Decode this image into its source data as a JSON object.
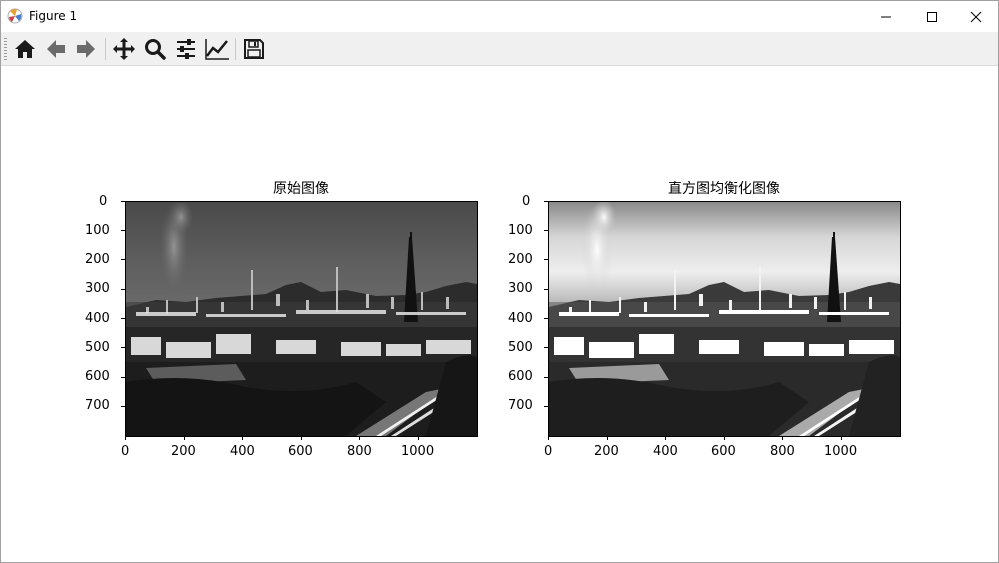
{
  "window": {
    "title": "Figure 1",
    "controls": [
      "minimize",
      "maximize",
      "close"
    ]
  },
  "toolbar": {
    "buttons": [
      {
        "name": "home",
        "icon": "home-icon"
      },
      {
        "name": "back",
        "icon": "arrow-left-icon"
      },
      {
        "name": "forward",
        "icon": "arrow-right-icon"
      },
      {
        "name": "pan",
        "icon": "move-icon"
      },
      {
        "name": "zoom",
        "icon": "magnifier-icon"
      },
      {
        "name": "configure-subplots",
        "icon": "sliders-icon"
      },
      {
        "name": "edit-axes",
        "icon": "line-chart-icon"
      },
      {
        "name": "save",
        "icon": "floppy-disk-icon"
      }
    ]
  },
  "subplots": [
    {
      "title": "原始图像",
      "image": "grayscale photograph of an industrial area at dusk",
      "xticks": [
        "0",
        "200",
        "400",
        "600",
        "800",
        "1000"
      ],
      "yticks": [
        "0",
        "100",
        "200",
        "300",
        "400",
        "500",
        "600",
        "700"
      ]
    },
    {
      "title": "直方图均衡化图像",
      "image": "histogram equalized grayscale photograph of an industrial area at dusk",
      "xticks": [
        "0",
        "200",
        "400",
        "600",
        "800",
        "1000"
      ],
      "yticks": [
        "0",
        "100",
        "200",
        "300",
        "400",
        "500",
        "600",
        "700"
      ]
    }
  ]
}
